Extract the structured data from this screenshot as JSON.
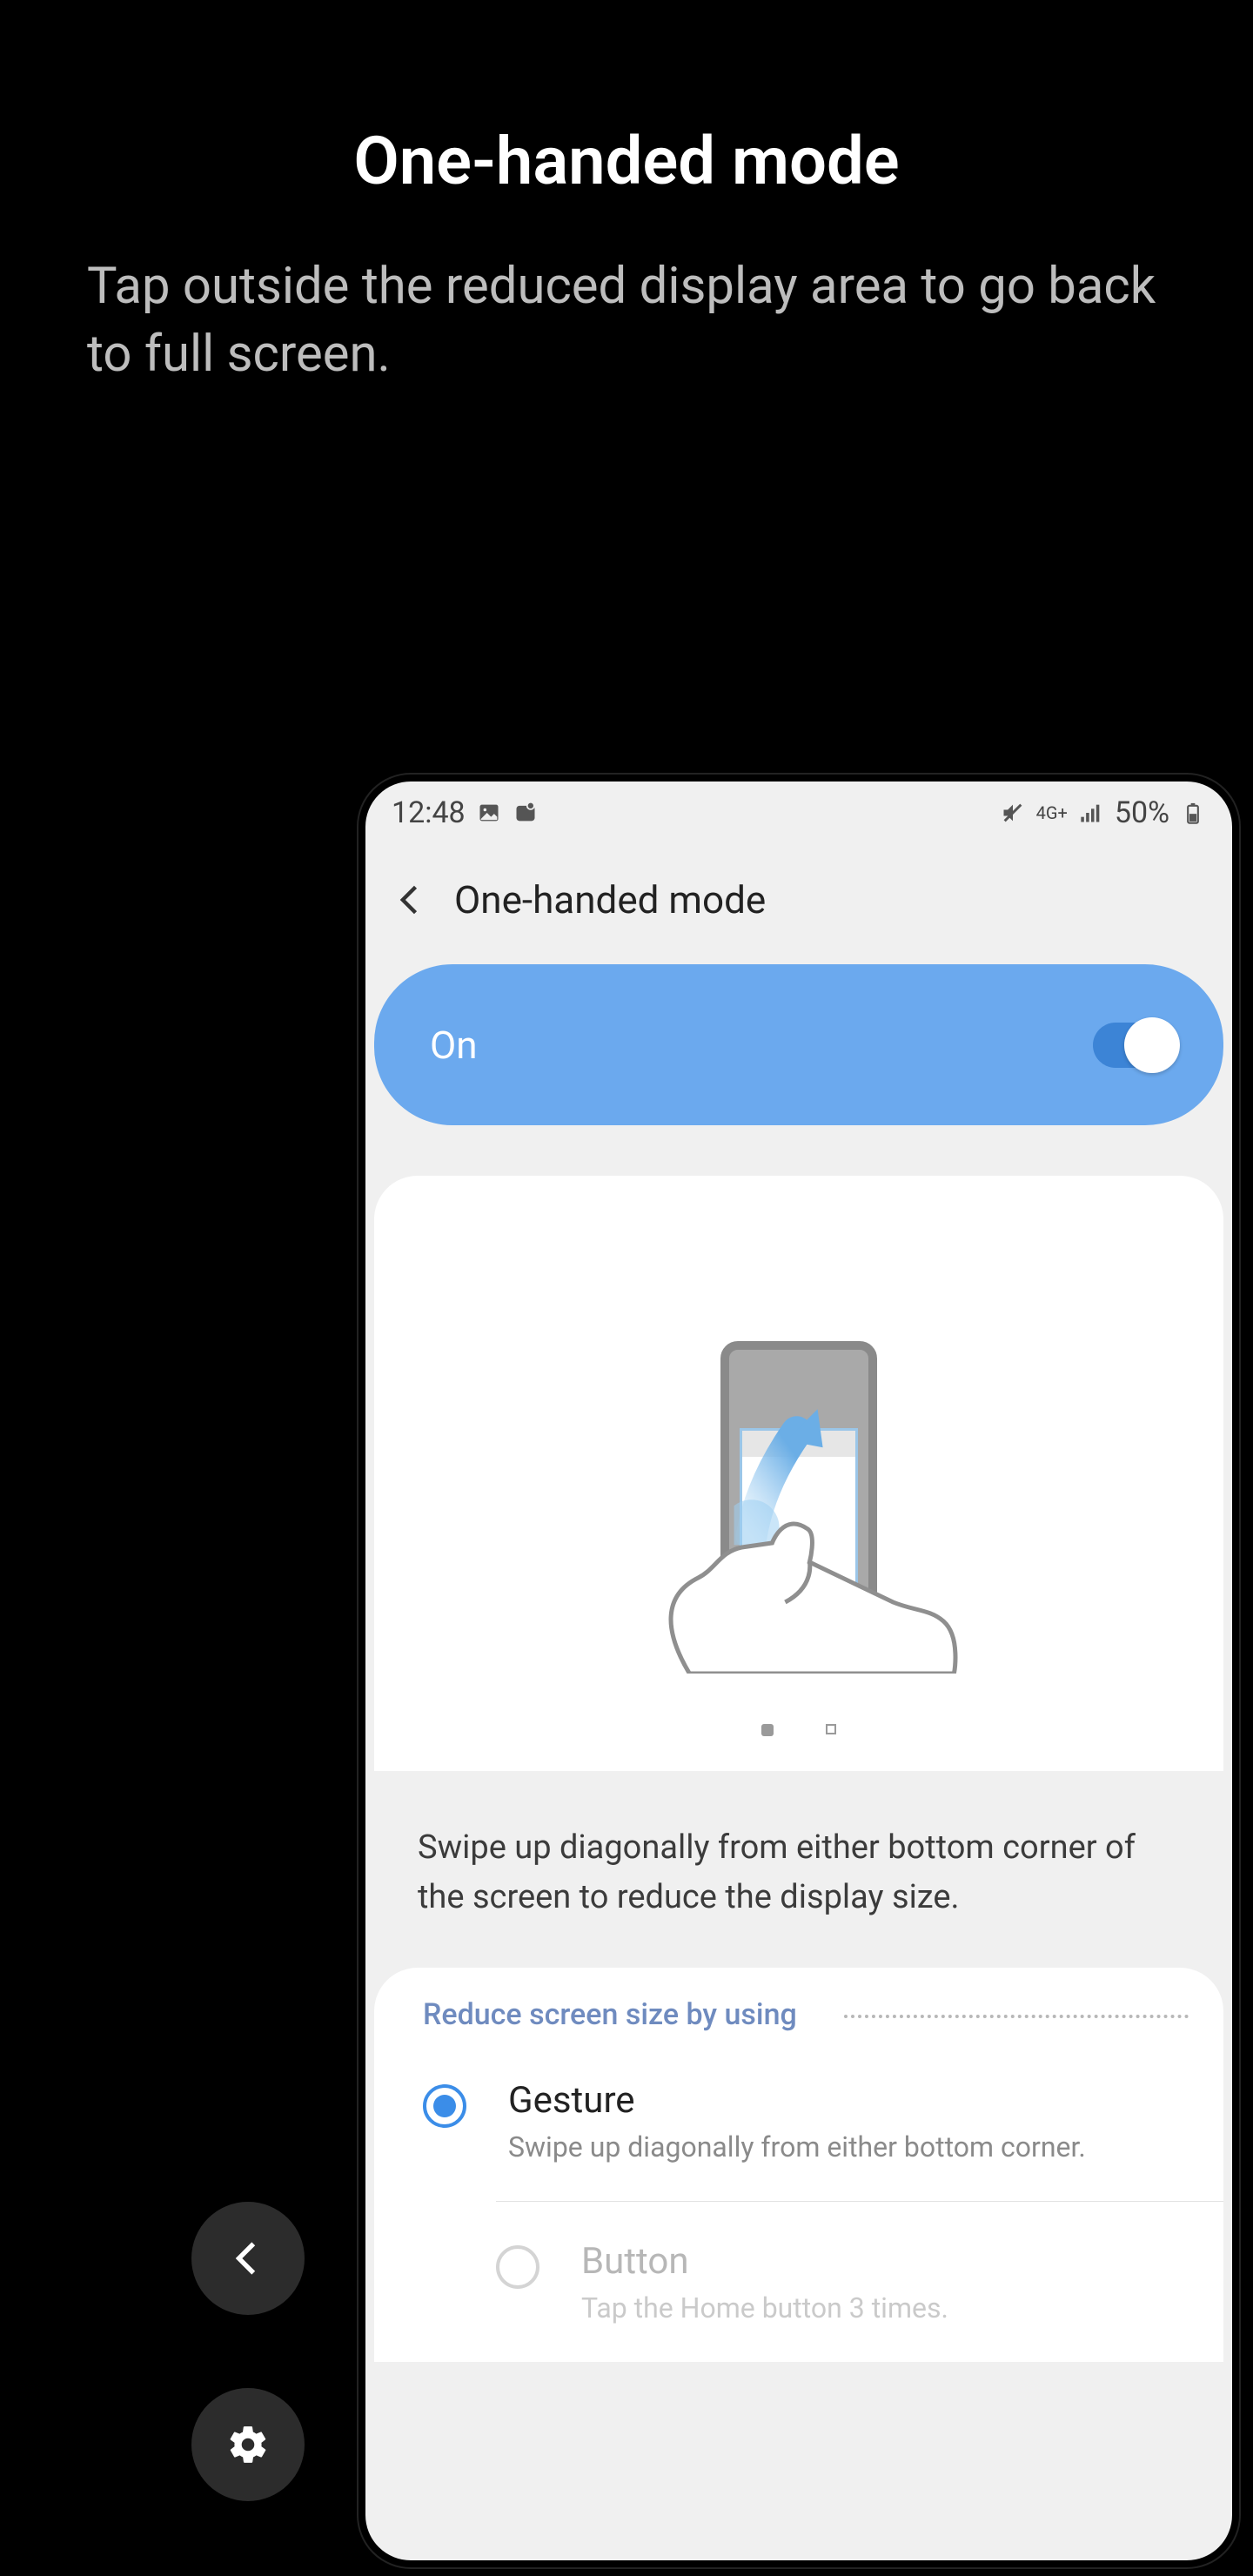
{
  "overlay": {
    "title": "One-handed mode",
    "subtext": "Tap outside the reduced display area to go back to full screen."
  },
  "statusbar": {
    "time": "12:48",
    "network_label": "4G+",
    "battery_text": "50%"
  },
  "header": {
    "title": "One-handed mode"
  },
  "main_toggle": {
    "label": "On",
    "enabled": true
  },
  "description": "Swipe up diagonally from either bottom corner of the screen to reduce the display size.",
  "section": {
    "label": "Reduce screen size by using",
    "options": [
      {
        "title": "Gesture",
        "subtitle": "Swipe up diagonally from either bottom corner.",
        "selected": true
      },
      {
        "title": "Button",
        "subtitle": "Tap the Home button 3 times.",
        "selected": false
      }
    ]
  }
}
